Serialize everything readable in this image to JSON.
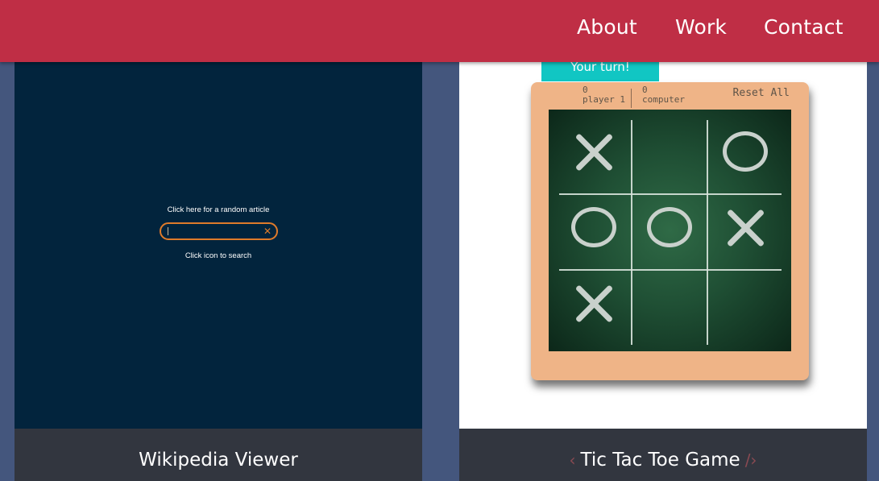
{
  "nav": {
    "items": [
      {
        "label": "About"
      },
      {
        "label": "Work"
      },
      {
        "label": "Contact"
      }
    ]
  },
  "projects": [
    {
      "title": "Wikipedia Viewer",
      "preview": {
        "random_label": "Click here for a random article",
        "search_value": "",
        "clear_icon": "close-icon",
        "hint": "Click icon to search"
      }
    },
    {
      "title": "Tic Tac Toe Game",
      "prev_arrow": "‹",
      "next_arrow": "/›",
      "preview": {
        "turn_text": "Your turn!",
        "player_score": "0",
        "player_label": "player 1",
        "computer_score": "0",
        "computer_label": "computer",
        "reset_label": "Reset All",
        "board": [
          "X",
          "",
          "O",
          "O",
          "O",
          "X",
          "X",
          "",
          ""
        ]
      }
    }
  ],
  "colors": {
    "navbar": "#bf2e45",
    "page_bg": "#44567d",
    "wiki_bg": "#02243d",
    "search_accent": "#e07b2a",
    "turn_banner": "#11c6c3",
    "board_frame": "#efb487",
    "caption_bg": "#32363f"
  }
}
